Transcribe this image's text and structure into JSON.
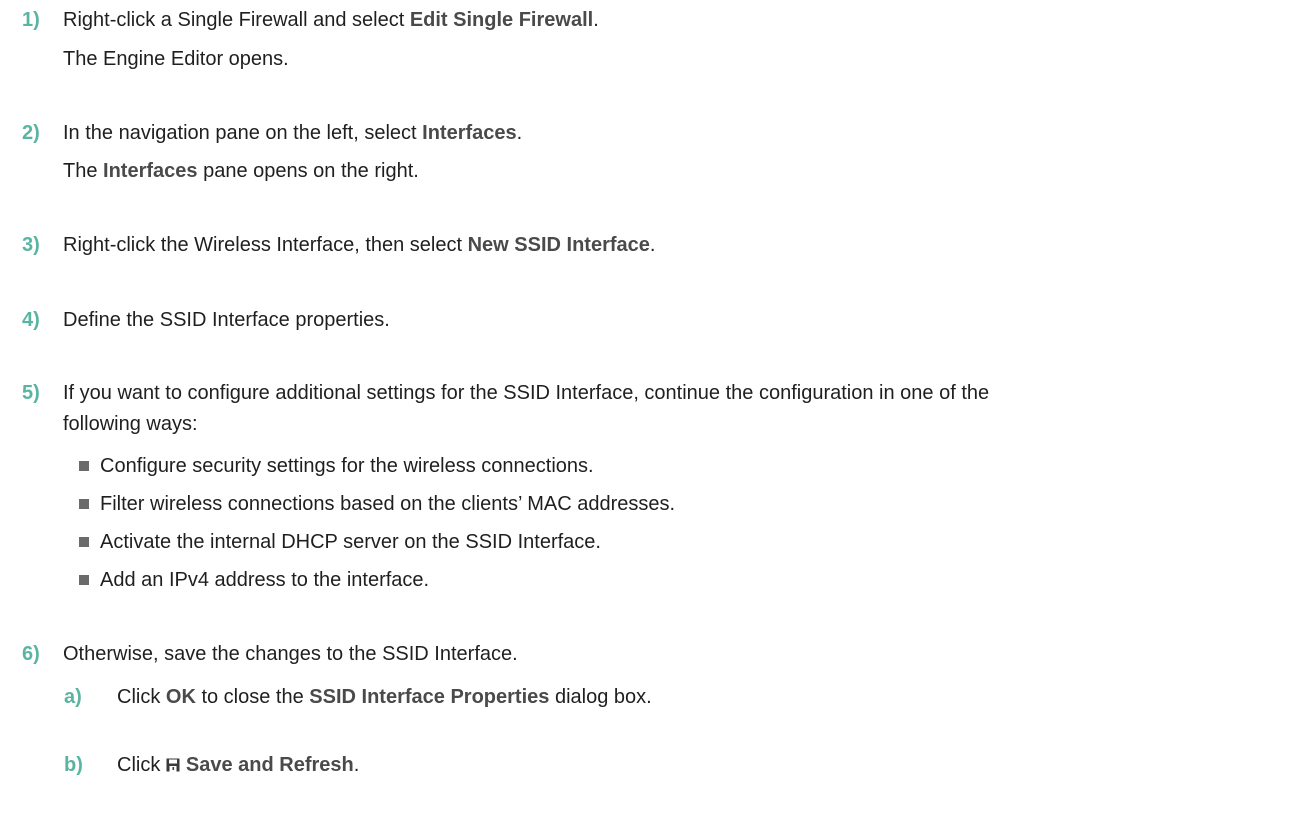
{
  "steps": [
    {
      "num": "1)",
      "pre": "Right-click a Single Firewall and select ",
      "bold": "Edit Single Firewall",
      "post": ".",
      "result": "The Engine Editor opens."
    },
    {
      "num": "2)",
      "pre": "In the navigation pane on the left, select ",
      "bold": "Interfaces",
      "post": ".",
      "result_pre": "The ",
      "result_bold": "Interfaces",
      "result_post": " pane opens on the right."
    },
    {
      "num": "3)",
      "pre": "Right-click the Wireless Interface, then select ",
      "bold": "New SSID Interface",
      "post": "."
    },
    {
      "num": "4)",
      "text": "Define the SSID Interface properties."
    },
    {
      "num": "5)",
      "line1": "If you want to configure additional settings for the SSID Interface, continue the configuration in one of the",
      "line2": "following ways:",
      "bullets": [
        "Configure security settings for the wireless connections.",
        "Filter wireless connections based on the clients’ MAC addresses.",
        "Activate the internal DHCP server on the SSID Interface.",
        "Add an IPv4 address to the interface."
      ]
    },
    {
      "num": "6)",
      "text": "Otherwise, save the changes to the SSID Interface.",
      "substeps": [
        {
          "num": "a)",
          "pre": "Click ",
          "bold1": "OK",
          "mid": " to close the ",
          "bold2": "SSID Interface Properties",
          "post": " dialog box."
        },
        {
          "num": "b)",
          "pre": "Click ",
          "icon": "save-icon",
          "bold": "Save and Refresh",
          "post": "."
        }
      ]
    }
  ],
  "colors": {
    "accent": "#5ab4a2",
    "text": "#1f1f1f",
    "bold_text": "#4a4a4a",
    "bullet": "#6b6b6b"
  }
}
